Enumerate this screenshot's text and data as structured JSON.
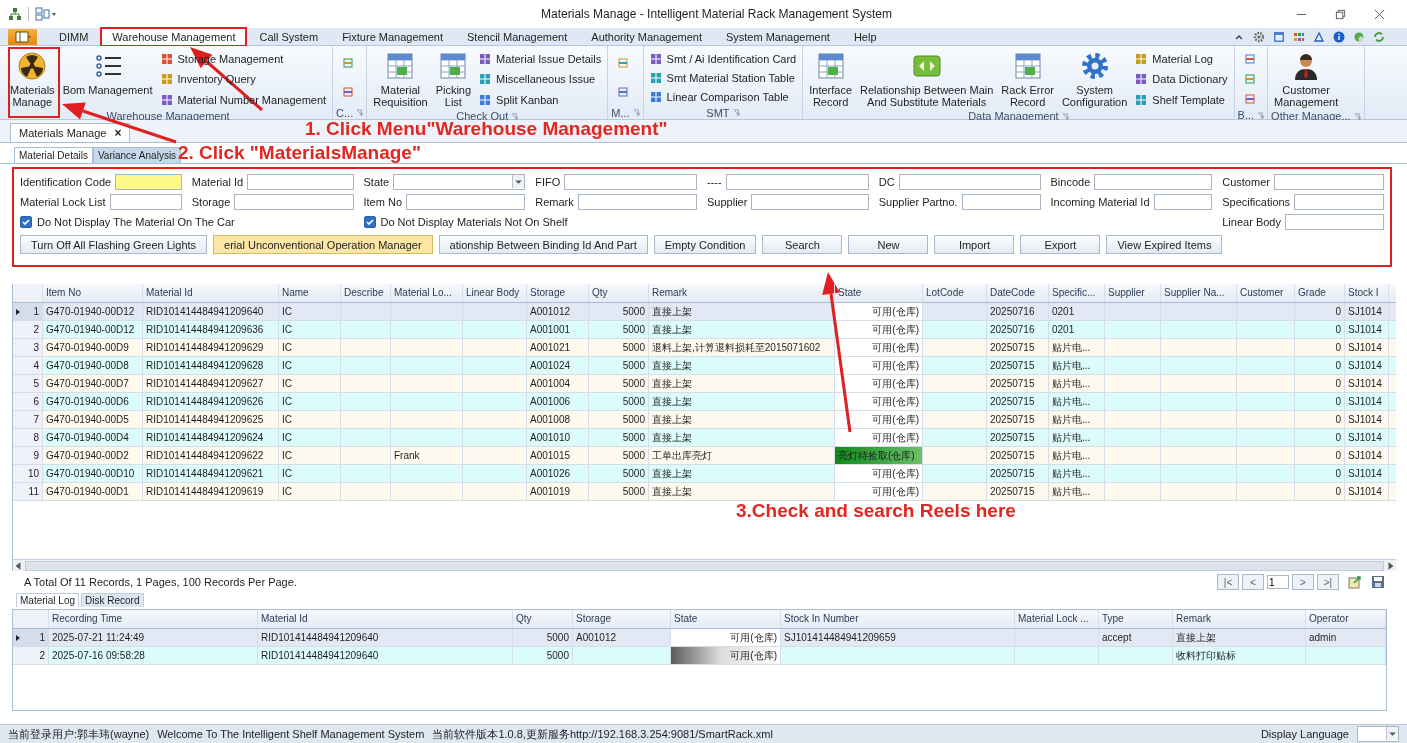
{
  "window": {
    "title": "Materials Manage - Intelligent Material Rack Management System"
  },
  "menu": {
    "tabs": [
      {
        "label": "DIMM",
        "selected": false
      },
      {
        "label": "Warehouse Management",
        "selected": true
      },
      {
        "label": "Call System",
        "selected": false
      },
      {
        "label": "Fixture Management",
        "selected": false
      },
      {
        "label": "Stencil Management",
        "selected": false
      },
      {
        "label": "Authority Management",
        "selected": false
      },
      {
        "label": "System Management",
        "selected": false
      },
      {
        "label": "Help",
        "selected": false
      }
    ]
  },
  "ribbon": {
    "groups": [
      {
        "label": "Warehouse Management",
        "launcher": false,
        "items": [
          {
            "kind": "large",
            "label": "Materials\nManage"
          },
          {
            "kind": "large",
            "label": "Bom Management"
          },
          {
            "kind": "small",
            "label": "Storage Management"
          },
          {
            "kind": "small",
            "label": "Inventory Query"
          },
          {
            "kind": "small",
            "label": "Material Number Management"
          }
        ]
      },
      {
        "label": "C...",
        "launcher": true,
        "items": [
          {
            "kind": "icon"
          },
          {
            "kind": "icon"
          }
        ]
      },
      {
        "label": "Check Out",
        "launcher": true,
        "items": [
          {
            "kind": "large",
            "label": "Material\nRequisition"
          },
          {
            "kind": "large",
            "label": "Picking\nList"
          },
          {
            "kind": "small",
            "label": "Material Issue Details"
          },
          {
            "kind": "small",
            "label": "Miscellaneous Issue"
          },
          {
            "kind": "small",
            "label": "Split Kanban"
          }
        ]
      },
      {
        "label": "M...",
        "launcher": true,
        "items": [
          {
            "kind": "icon"
          },
          {
            "kind": "icon"
          }
        ]
      },
      {
        "label": "SMT",
        "launcher": true,
        "items": [
          {
            "kind": "small",
            "label": "Smt / Ai Identification Card"
          },
          {
            "kind": "small",
            "label": "Smt Material Station Table"
          },
          {
            "kind": "small",
            "label": "Linear Comparison Table"
          }
        ]
      },
      {
        "label": "Data Management",
        "launcher": true,
        "items": [
          {
            "kind": "large",
            "label": "Interface\nRecord"
          },
          {
            "kind": "large",
            "label": "Relationship Between Main\nAnd Substitute Materials"
          },
          {
            "kind": "large",
            "label": "Rack Error\nRecord"
          },
          {
            "kind": "large",
            "label": "System\nConfiguration"
          },
          {
            "kind": "small",
            "label": "Material Log"
          },
          {
            "kind": "small",
            "label": "Data Dictionary"
          },
          {
            "kind": "small",
            "label": "Shelf Template"
          }
        ]
      },
      {
        "label": "B...",
        "launcher": true,
        "items": [
          {
            "kind": "icon"
          },
          {
            "kind": "icon"
          },
          {
            "kind": "icon"
          }
        ]
      },
      {
        "label": "Other Manage...",
        "launcher": true,
        "items": [
          {
            "kind": "large",
            "label": "Customer\nManagement"
          }
        ]
      }
    ]
  },
  "document_tab": {
    "label": "Materials Manage",
    "close": "×"
  },
  "subtabs": [
    {
      "label": "Material Details",
      "selected": true
    },
    {
      "label": "Variance Analysis",
      "selected": false
    }
  ],
  "form": {
    "rows": [
      [
        {
          "kind": "text",
          "label": "Identification Code",
          "highlighted": true
        },
        {
          "kind": "text",
          "label": "Material Id",
          "highlighted": false
        },
        {
          "kind": "select",
          "label": "State",
          "highlighted": false
        },
        {
          "kind": "text",
          "label": "FIFO",
          "highlighted": false
        },
        {
          "kind": "text",
          "label": "----",
          "highlighted": false
        },
        {
          "kind": "text",
          "label": "DC",
          "highlighted": false
        },
        {
          "kind": "text",
          "label": "Bincode",
          "highlighted": false
        },
        {
          "kind": "text",
          "label": "Customer",
          "highlighted": false
        }
      ],
      [
        {
          "kind": "text",
          "label": "Material Lock List",
          "highlighted": false
        },
        {
          "kind": "text",
          "label": "Storage",
          "highlighted": false
        },
        {
          "kind": "text",
          "label": "Item No",
          "highlighted": false
        },
        {
          "kind": "text",
          "label": "Remark",
          "highlighted": false
        },
        {
          "kind": "text",
          "label": "Supplier",
          "highlighted": false
        },
        {
          "kind": "text",
          "label": "Supplier Partno.",
          "highlighted": false
        },
        {
          "kind": "text",
          "label": "Incoming Material Id",
          "highlighted": false
        },
        {
          "kind": "text",
          "label": "Specifications",
          "highlighted": false
        }
      ],
      [
        {
          "kind": "checkbox",
          "label": "Do Not Display The Material On The Car",
          "checked": true
        },
        {
          "kind": "empty"
        },
        {
          "kind": "checkbox",
          "label": "Do Not Display Materials Not On Shelf",
          "checked": true
        },
        {
          "kind": "empty"
        },
        {
          "kind": "empty"
        },
        {
          "kind": "empty"
        },
        {
          "kind": "empty"
        },
        {
          "kind": "text",
          "label": "Linear Body",
          "highlighted": false
        }
      ]
    ],
    "buttons": [
      {
        "label": "Turn Off All Flashing Green Lights",
        "highlighted": false
      },
      {
        "label": "erial Unconventional Operation Manager",
        "highlighted": true
      },
      {
        "label": "ationship Between Binding Id And Part",
        "highlighted": false
      },
      {
        "label": "Empty Condition",
        "highlighted": false
      },
      {
        "label": "Search",
        "highlighted": false
      },
      {
        "label": "New",
        "highlighted": false
      },
      {
        "label": "Import",
        "highlighted": false
      },
      {
        "label": "Export",
        "highlighted": false
      },
      {
        "label": "View Expired Items",
        "highlighted": false
      }
    ]
  },
  "grid": {
    "columns": [
      "Item No",
      "Material Id",
      "Name",
      "Describe",
      "Material Lo...",
      "Linear Body",
      "Storage",
      "Qty",
      "Remark",
      "State",
      "LotCode",
      "DateCode",
      "Specific...",
      "Supplier",
      "Supplier Na...",
      "Customer",
      "Grade",
      "Stock I"
    ],
    "rows": [
      {
        "no": "1",
        "selected": true,
        "lit": false,
        "item_no": "G470-01940-00D12",
        "material_id": "RID101414484941209640",
        "name": "IC",
        "storage": "A001012",
        "qty": "5000",
        "remark": "直接上架",
        "state": "可用(仓库)",
        "datecode": "20250716",
        "specification": "0201",
        "grade": "0",
        "stock": "SJ1014"
      },
      {
        "no": "2",
        "selected": false,
        "lit": false,
        "item_no": "G470-01940-00D12",
        "material_id": "RID101414484941209636",
        "name": "IC",
        "storage": "A001001",
        "qty": "5000",
        "remark": "直接上架",
        "state": "可用(仓库)",
        "datecode": "20250716",
        "specification": "0201",
        "grade": "0",
        "stock": "SJ1014"
      },
      {
        "no": "3",
        "selected": false,
        "lit": false,
        "item_no": "G470-01940-00D9",
        "material_id": "RID101414484941209629",
        "name": "IC",
        "storage": "A001021",
        "qty": "5000",
        "remark": "退料上架,计算退料损耗至2015071602",
        "state": "可用(仓库)",
        "datecode": "20250715",
        "specification": "贴片电...",
        "grade": "0",
        "stock": "SJ1014"
      },
      {
        "no": "4",
        "selected": false,
        "lit": false,
        "item_no": "G470-01940-00D8",
        "material_id": "RID101414484941209628",
        "name": "IC",
        "storage": "A001024",
        "qty": "5000",
        "remark": "直接上架",
        "state": "可用(仓库)",
        "datecode": "20250715",
        "specification": "贴片电...",
        "grade": "0",
        "stock": "SJ1014"
      },
      {
        "no": "5",
        "selected": false,
        "lit": false,
        "item_no": "G470-01940-00D7",
        "material_id": "RID101414484941209627",
        "name": "IC",
        "storage": "A001004",
        "qty": "5000",
        "remark": "直接上架",
        "state": "可用(仓库)",
        "datecode": "20250715",
        "specification": "贴片电...",
        "grade": "0",
        "stock": "SJ1014"
      },
      {
        "no": "6",
        "selected": false,
        "lit": false,
        "item_no": "G470-01940-00D6",
        "material_id": "RID101414484941209626",
        "name": "IC",
        "storage": "A001006",
        "qty": "5000",
        "remark": "直接上架",
        "state": "可用(仓库)",
        "datecode": "20250715",
        "specification": "贴片电...",
        "grade": "0",
        "stock": "SJ1014"
      },
      {
        "no": "7",
        "selected": false,
        "lit": false,
        "item_no": "G470-01940-00D5",
        "material_id": "RID101414484941209625",
        "name": "IC",
        "storage": "A001008",
        "qty": "5000",
        "remark": "直接上架",
        "state": "可用(仓库)",
        "datecode": "20250715",
        "specification": "贴片电...",
        "grade": "0",
        "stock": "SJ1014"
      },
      {
        "no": "8",
        "selected": false,
        "lit": false,
        "item_no": "G470-01940-00D4",
        "material_id": "RID101414484941209624",
        "name": "IC",
        "storage": "A001010",
        "qty": "5000",
        "remark": "直接上架",
        "state": "可用(仓库)",
        "datecode": "20250715",
        "specification": "贴片电...",
        "grade": "0",
        "stock": "SJ1014"
      },
      {
        "no": "9",
        "selected": false,
        "lit": true,
        "item_no": "G470-01940-00D2",
        "material_id": "RID101414484941209622",
        "name": "IC",
        "material_lot": "Frank",
        "storage": "A001015",
        "qty": "5000",
        "remark": "工单出库亮灯",
        "state": "亮灯待捡取(仓库)",
        "datecode": "20250715",
        "specification": "贴片电...",
        "grade": "0",
        "stock": "SJ1014"
      },
      {
        "no": "10",
        "selected": false,
        "lit": false,
        "item_no": "G470-01940-00D10",
        "material_id": "RID101414484941209621",
        "name": "IC",
        "storage": "A001026",
        "qty": "5000",
        "remark": "直接上架",
        "state": "可用(仓库)",
        "datecode": "20250715",
        "specification": "贴片电...",
        "grade": "0",
        "stock": "SJ1014"
      },
      {
        "no": "11",
        "selected": false,
        "lit": false,
        "item_no": "G470-01940-00D1",
        "material_id": "RID101414484941209619",
        "name": "IC",
        "storage": "A001019",
        "qty": "5000",
        "remark": "直接上架",
        "state": "可用(仓库)",
        "datecode": "20250715",
        "specification": "贴片电...",
        "grade": "0",
        "stock": "SJ1014"
      }
    ]
  },
  "pager": {
    "summary": "A Total Of 11 Records, 1 Pages, 100 Records Per Page.",
    "first": "|<",
    "prev": "<",
    "page": "1",
    "next": ">",
    "last": ">|"
  },
  "bottom_tabs": [
    {
      "label": "Material Log",
      "selected": true
    },
    {
      "label": "Disk Record",
      "selected": false
    }
  ],
  "log_grid": {
    "columns": [
      "Recording Time",
      "Material Id",
      "Qty",
      "Storage",
      "State",
      "Stock In Number",
      "Material Lock ...",
      "Type",
      "Remark",
      "Operator"
    ],
    "rows": [
      {
        "no": "1",
        "selected": true,
        "shaded": false,
        "recording_time": "2025-07-21 11:24:49",
        "material_id": "RID101414484941209640",
        "qty": "5000",
        "storage": "A001012",
        "state": "可用(仓库)",
        "stock_in_number": "SJ101414484941209659",
        "type": "accept",
        "remark": "直接上架",
        "operator": "admin"
      },
      {
        "no": "2",
        "selected": false,
        "shaded": true,
        "recording_time": "2025-07-16 09:58:28",
        "material_id": "RID101414484941209640",
        "qty": "5000",
        "state": "可用(仓库)",
        "remark": "收料打印贴标"
      }
    ]
  },
  "status_bar": {
    "texts": [
      "当前登录用户:郭丰玮(wayne)",
      "Welcome To The Intelligent Shelf Management System",
      "当前软件版本1.0.8,更新服务http://192.168.3.254:9081/SmartRack.xml"
    ],
    "language_label": "Display Language"
  },
  "annotations": [
    "1. Click Menu\"Warehouse Management\"",
    "2. Click \"MaterialsManage\"",
    "3.Check and search Reels here"
  ]
}
